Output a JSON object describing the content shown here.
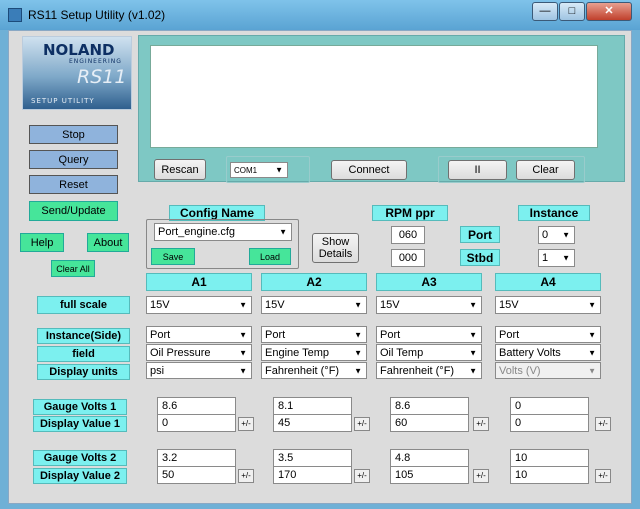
{
  "window": {
    "title": "RS11 Setup Utility (v1.02)",
    "minimize": "—",
    "maximize": "□",
    "close": "✕"
  },
  "logo": {
    "brand": "NOLAND",
    "sub": "ENGINEERING",
    "product": "RS11",
    "tagline": "SETUP UTILITY"
  },
  "left_buttons": {
    "stop": "Stop",
    "query": "Query",
    "reset": "Reset",
    "send_update": "Send/Update",
    "help": "Help",
    "about": "About",
    "clear_all": "Clear All"
  },
  "console": {
    "text": "",
    "rescan": "Rescan",
    "com_port": "COM1",
    "connect": "Connect",
    "pause": "II",
    "clear": "Clear"
  },
  "config": {
    "label": "Config Name",
    "file": "Port_engine.cfg",
    "save": "Save",
    "load": "Load",
    "show_details": "Show Details"
  },
  "rpm": {
    "label": "RPM ppr",
    "port_value": "060",
    "stbd_value": "000",
    "port_label": "Port",
    "stbd_label": "Stbd"
  },
  "instance": {
    "label": "Instance",
    "port_value": "0",
    "stbd_value": "1"
  },
  "columns": [
    "A1",
    "A2",
    "A3",
    "A4"
  ],
  "row_labels": {
    "full_scale": "full scale",
    "instance_side": "Instance(Side)",
    "field": "field",
    "display_units": "Display units",
    "gauge_volts_1": "Gauge Volts 1",
    "display_value_1": "Display Value 1",
    "gauge_volts_2": "Gauge Volts 2",
    "display_value_2": "Display Value 2"
  },
  "channels": [
    {
      "full_scale": "15V",
      "side": "Port",
      "field": "Oil Pressure",
      "units": "psi",
      "gv1": "8.6",
      "dv1": "0",
      "gv2": "3.2",
      "dv2": "50"
    },
    {
      "full_scale": "15V",
      "side": "Port",
      "field": "Engine Temp",
      "units": "Fahrenheit (°F)",
      "gv1": "8.1",
      "dv1": "45",
      "gv2": "3.5",
      "dv2": "170"
    },
    {
      "full_scale": "15V",
      "side": "Port",
      "field": "Oil Temp",
      "units": "Fahrenheit (°F)",
      "gv1": "8.6",
      "dv1": "60",
      "gv2": "4.8",
      "dv2": "105"
    },
    {
      "full_scale": "15V",
      "side": "Port",
      "field": "Battery Volts",
      "units": "Volts (V)",
      "gv1": "0",
      "dv1": "0",
      "gv2": "10",
      "dv2": "10"
    }
  ],
  "plus_minus": "+/-",
  "icons": {
    "dropdown": "chevron-down-icon",
    "app": "app-icon"
  }
}
